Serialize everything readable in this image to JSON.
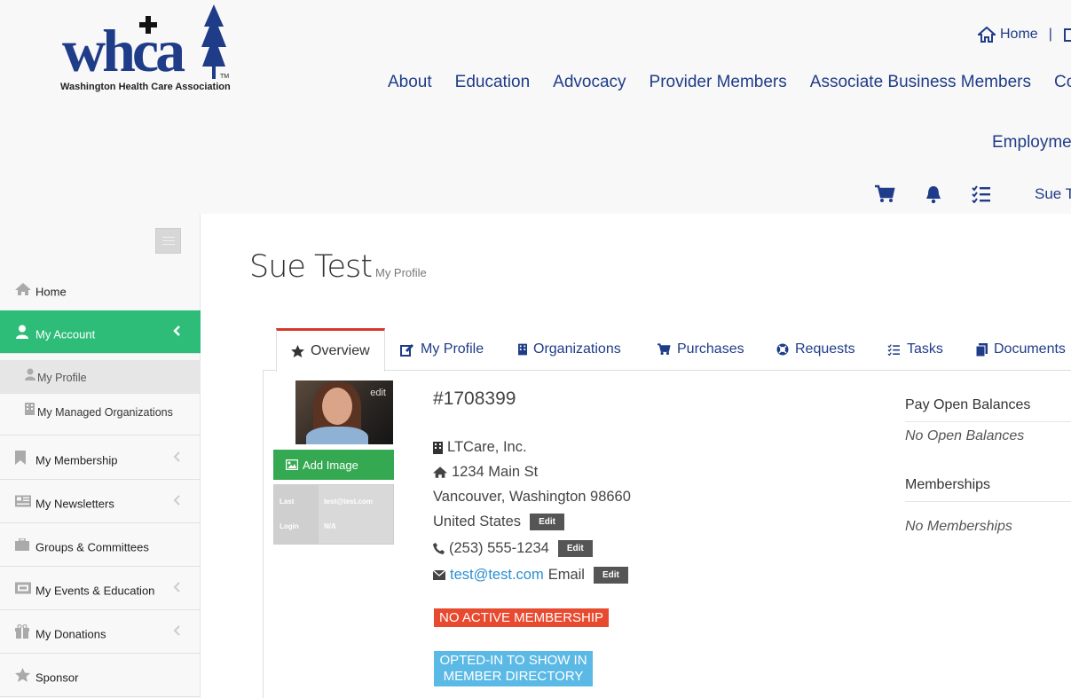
{
  "header": {
    "logo_text": "whca",
    "logo_subtitle": "Washington Health Care Association",
    "logo_tm": "TM",
    "top_links": {
      "home": "Home",
      "separator": "|"
    },
    "nav": [
      "About",
      "Education",
      "Advocacy",
      "Provider Members",
      "Associate Business Members",
      "Con"
    ],
    "nav_row2": "Employmen",
    "user_name": "Sue Tes"
  },
  "sidebar": {
    "items": [
      {
        "label": "Home"
      },
      {
        "label": "My Account"
      },
      {
        "label": "My Profile"
      },
      {
        "label": "My Managed Organizations"
      },
      {
        "label": "My Membership"
      },
      {
        "label": "My Newsletters"
      },
      {
        "label": "Groups & Committees"
      },
      {
        "label": "My Events & Education"
      },
      {
        "label": "My Donations"
      },
      {
        "label": "Sponsor"
      }
    ],
    "chevron": "‹"
  },
  "page": {
    "title": "Sue Test",
    "subtitle": "My Profile"
  },
  "tabs": [
    "Overview",
    "My Profile",
    "Organizations",
    "Purchases",
    "Requests",
    "Tasks",
    "Documents"
  ],
  "profile": {
    "photo_edit": "edit",
    "add_image": "Add Image",
    "last_login": {
      "label1": "Last",
      "label2": "Login",
      "value1": "test@test.com",
      "value2": "N/A"
    },
    "member_id": "#1708399",
    "organization": "LTCare, Inc.",
    "address1": "1234 Main St",
    "address2": "Vancouver, Washington 98660",
    "country": "United States",
    "phone": "(253) 555-1234",
    "email": "test@test.com",
    "email_label": "Email",
    "edit_label": "Edit",
    "badge_membership": "NO ACTIVE MEMBERSHIP",
    "badge_directory_line1": "OPTED-IN TO SHOW IN",
    "badge_directory_line2": "MEMBER DIRECTORY"
  },
  "right": {
    "balances_title": "Pay Open Balances",
    "balances_note": "No Open Balances",
    "memberships_title": "Memberships",
    "memberships_note": "No Memberships"
  },
  "colors": {
    "brand_blue": "#1f3c88",
    "active_green": "#2dbd79",
    "add_image_green": "#35a852",
    "badge_red": "#e84a2f",
    "badge_blue": "#5bb9e6",
    "tab_accent": "#d33a2c",
    "link_blue": "#2a8fd0"
  }
}
